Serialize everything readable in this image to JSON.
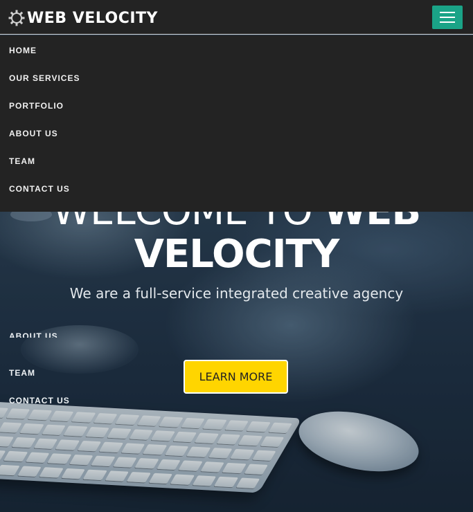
{
  "brand": {
    "name": "WEB VELOCITY",
    "icon": "gear-icon"
  },
  "menu_toggle": {
    "icon": "hamburger-menu-icon",
    "color": "#1aa387"
  },
  "nav": {
    "items": [
      {
        "label": "HOME"
      },
      {
        "label": "OUR SERVICES"
      },
      {
        "label": "PORTFOLIO"
      },
      {
        "label": "ABOUT US"
      },
      {
        "label": "TEAM"
      },
      {
        "label": "CONTACT US"
      }
    ]
  },
  "hero": {
    "title_light": "WELCOME TO ",
    "title_bold_1": "WEB",
    "title_bold_2": "VELOCITY",
    "subtitle": "We are a full-service integrated creative agency",
    "cta_label": "LEARN MORE",
    "cta_color": "#ffd500"
  },
  "ghost_nav": {
    "items": [
      {
        "label": "ABOUT US"
      },
      {
        "label": "TEAM"
      },
      {
        "label": "CONTACT US"
      }
    ]
  }
}
